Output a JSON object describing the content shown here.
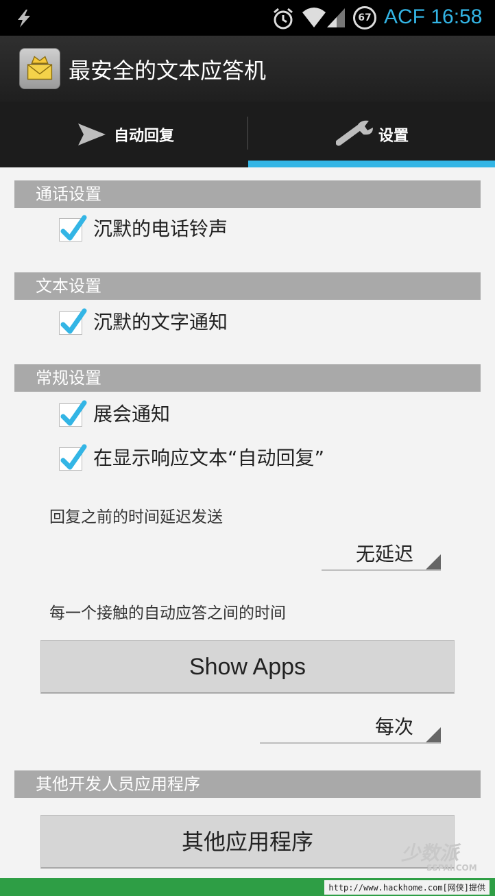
{
  "status_bar": {
    "carrier_time": "ACF 16:58",
    "battery_level": "67"
  },
  "action_bar": {
    "title": "最安全的文本应答机"
  },
  "tabs": [
    {
      "label": "自动回复",
      "icon": "send-icon",
      "selected": false
    },
    {
      "label": "设置",
      "icon": "wrench-icon",
      "selected": true
    }
  ],
  "sections": {
    "call": {
      "header": "通话设置",
      "items": [
        {
          "label": "沉默的电话铃声",
          "checked": true
        }
      ]
    },
    "text": {
      "header": "文本设置",
      "items": [
        {
          "label": "沉默的文字通知",
          "checked": true
        }
      ]
    },
    "general": {
      "header": "常规设置",
      "items": [
        {
          "label": "展会通知",
          "checked": true
        },
        {
          "label": "在显示响应文本“自动回复”",
          "checked": true
        }
      ],
      "delay_label": "回复之前的时间延迟发送",
      "delay_value": "无延迟",
      "interval_label": "每一个接触的自动应答之间的时间",
      "show_apps_button": "Show Apps",
      "interval_value": "每次"
    },
    "other": {
      "header": "其他开发人员应用程序",
      "button": "其他应用程序"
    }
  },
  "watermark": {
    "logo": "少数派",
    "sub": "SSPAI.COM"
  },
  "bottom_strip": {
    "url_text": "http://www.hackhome.com[网侠]提供"
  },
  "colors": {
    "accent": "#33b5e5",
    "section_header": "#a9a9a9",
    "strip": "#2e9e45"
  }
}
